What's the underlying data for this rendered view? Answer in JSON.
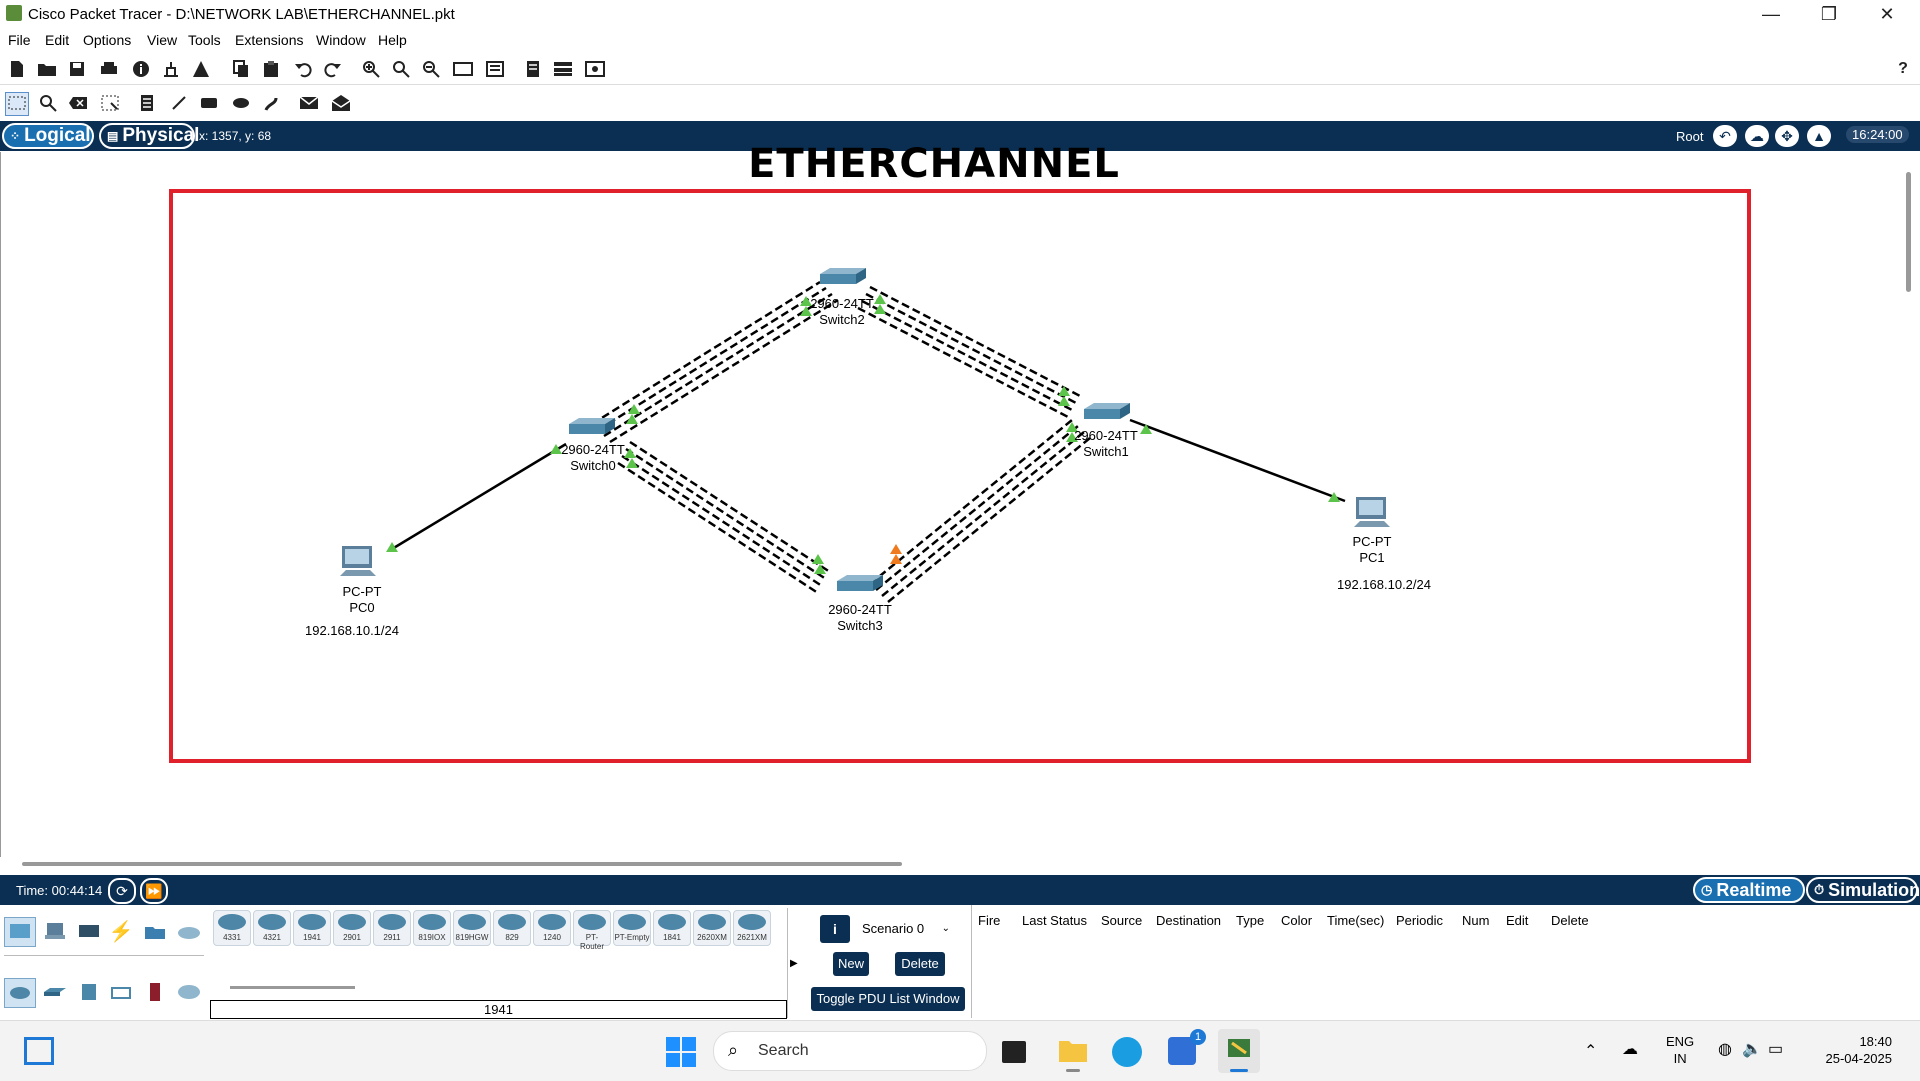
{
  "window": {
    "title": "Cisco Packet Tracer - D:\\NETWORK LAB\\ETHERCHANNEL.pkt",
    "minimize": "—",
    "restore": "❐",
    "close": "✕"
  },
  "menu": [
    "File",
    "Edit",
    "Options",
    "View",
    "Tools",
    "Extensions",
    "Window",
    "Help"
  ],
  "help_icon": "?",
  "modebar": {
    "logical": "Logical",
    "physical": "Physical",
    "coords": "x: 1357, y: 68",
    "root": "Root",
    "clock": "16:24:00"
  },
  "canvas": {
    "title": "ETHERCHANNEL",
    "frame_color": "#e0202a",
    "link_color": "#000000",
    "up_indicator_color": "#5cc44a",
    "blocked_indicator_color": "#f07a1e",
    "devices": {
      "pc0": {
        "type": "PC-PT",
        "name": "PC0",
        "ip": "192.168.10.1/24"
      },
      "pc1": {
        "type": "PC-PT",
        "name": "PC1",
        "ip": "192.168.10.2/24"
      },
      "switch0": {
        "type": "2960-24TT",
        "name": "Switch0"
      },
      "switch1": {
        "type": "2960-24TT",
        "name": "Switch1"
      },
      "switch2": {
        "type": "2960-24TT",
        "name": "Switch2"
      },
      "switch3": {
        "type": "2960-24TT",
        "name": "Switch3"
      }
    }
  },
  "simbar": {
    "time": "Time: 00:44:14",
    "realtime": "Realtime",
    "simulation": "Simulation"
  },
  "device_models": [
    "4331",
    "4321",
    "1941",
    "2901",
    "2911",
    "819IOX",
    "819HGW",
    "829",
    "1240",
    "PT-Router",
    "PT-Empty",
    "1841",
    "2620XM",
    "2621XM"
  ],
  "selected_model": "1941",
  "scenario": {
    "selected": "Scenario 0",
    "new": "New",
    "delete": "Delete",
    "toggle": "Toggle PDU List Window"
  },
  "pdu_columns": [
    "Fire",
    "Last Status",
    "Source",
    "Destination",
    "Type",
    "Color",
    "Time(sec)",
    "Periodic",
    "Num",
    "Edit",
    "Delete"
  ],
  "taskbar": {
    "search": "Search",
    "lang": "ENG",
    "region": "IN",
    "time": "18:40",
    "date": "25-04-2025",
    "store_badge": "1"
  }
}
